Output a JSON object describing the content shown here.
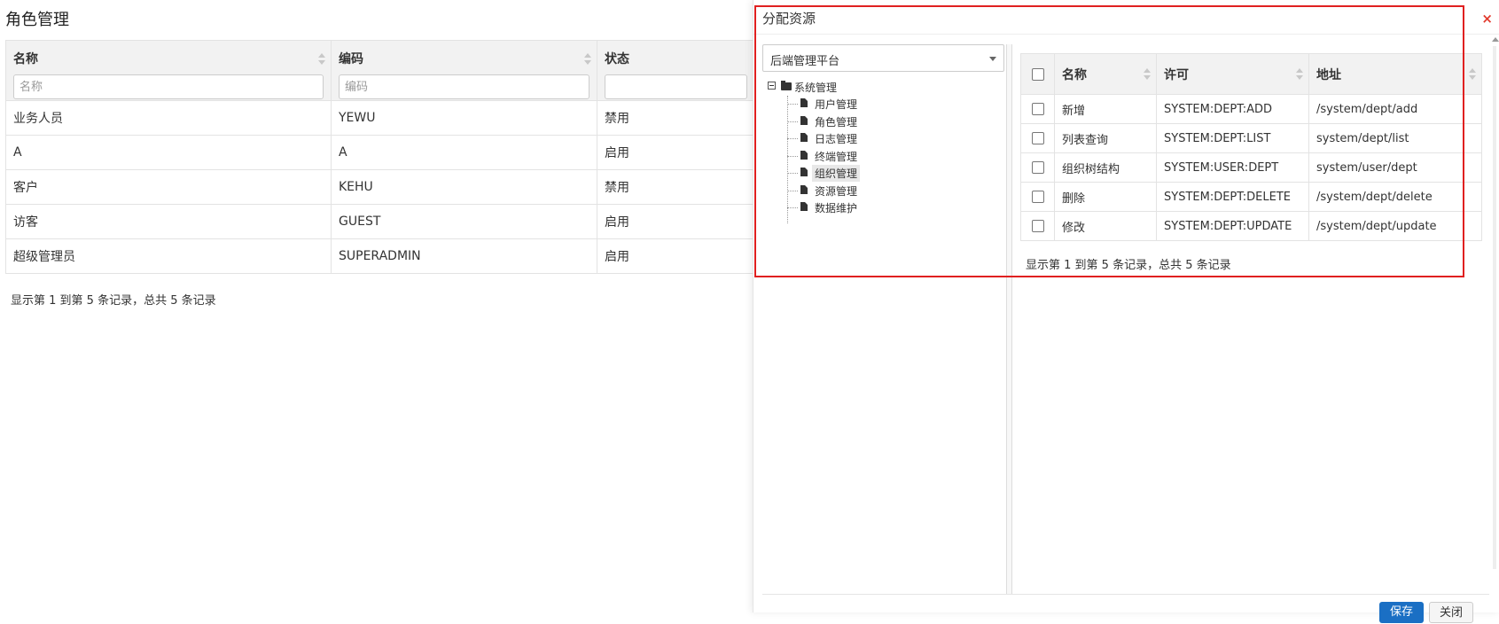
{
  "page": {
    "title": "角色管理"
  },
  "role_table": {
    "headers": {
      "name": "名称",
      "code": "编码",
      "status": "状态"
    },
    "filters": {
      "name_placeholder": "名称",
      "code_placeholder": "编码"
    },
    "rows": [
      {
        "name": "业务人员",
        "code": "YEWU",
        "status": "禁用",
        "status_color": "#e07b74"
      },
      {
        "name": "A",
        "code": "A",
        "status": "启用",
        "status_color": "#5cb85c"
      },
      {
        "name": "客户",
        "code": "KEHU",
        "status": "禁用",
        "status_color": "#e07b74"
      },
      {
        "name": "访客",
        "code": "GUEST",
        "status": "启用",
        "status_color": "#5cb85c"
      },
      {
        "name": "超级管理员",
        "code": "SUPERADMIN",
        "status": "启用",
        "status_color": "#5cb85c"
      }
    ],
    "footer": "显示第 1 到第 5 条记录，总共 5 条记录"
  },
  "modal": {
    "title": "分配资源",
    "close_icon": "×",
    "platform_select": {
      "value": "后端管理平台"
    },
    "tree": {
      "root": "系统管理",
      "children": [
        "用户管理",
        "角色管理",
        "日志管理",
        "终端管理",
        "组织管理",
        "资源管理",
        "数据维护"
      ],
      "selected": "组织管理"
    },
    "resource_table": {
      "headers": {
        "name": "名称",
        "permission": "许可",
        "address": "地址"
      },
      "rows": [
        {
          "name": "新增",
          "permission": "SYSTEM:DEPT:ADD",
          "address": "/system/dept/add"
        },
        {
          "name": "列表查询",
          "permission": "SYSTEM:DEPT:LIST",
          "address": "system/dept/list"
        },
        {
          "name": "组织树结构",
          "permission": "SYSTEM:USER:DEPT",
          "address": "system/user/dept"
        },
        {
          "name": "删除",
          "permission": "SYSTEM:DEPT:DELETE",
          "address": "/system/dept/delete"
        },
        {
          "name": "修改",
          "permission": "SYSTEM:DEPT:UPDATE",
          "address": "/system/dept/update"
        }
      ],
      "footer": "显示第 1 到第 5 条记录，总共 5 条记录"
    },
    "buttons": {
      "save": "保存",
      "close": "关闭"
    }
  },
  "colors": {
    "highlight": "#e02020",
    "primary": "#1a6fc4",
    "danger": "#e07b74",
    "success": "#5cb85c"
  }
}
